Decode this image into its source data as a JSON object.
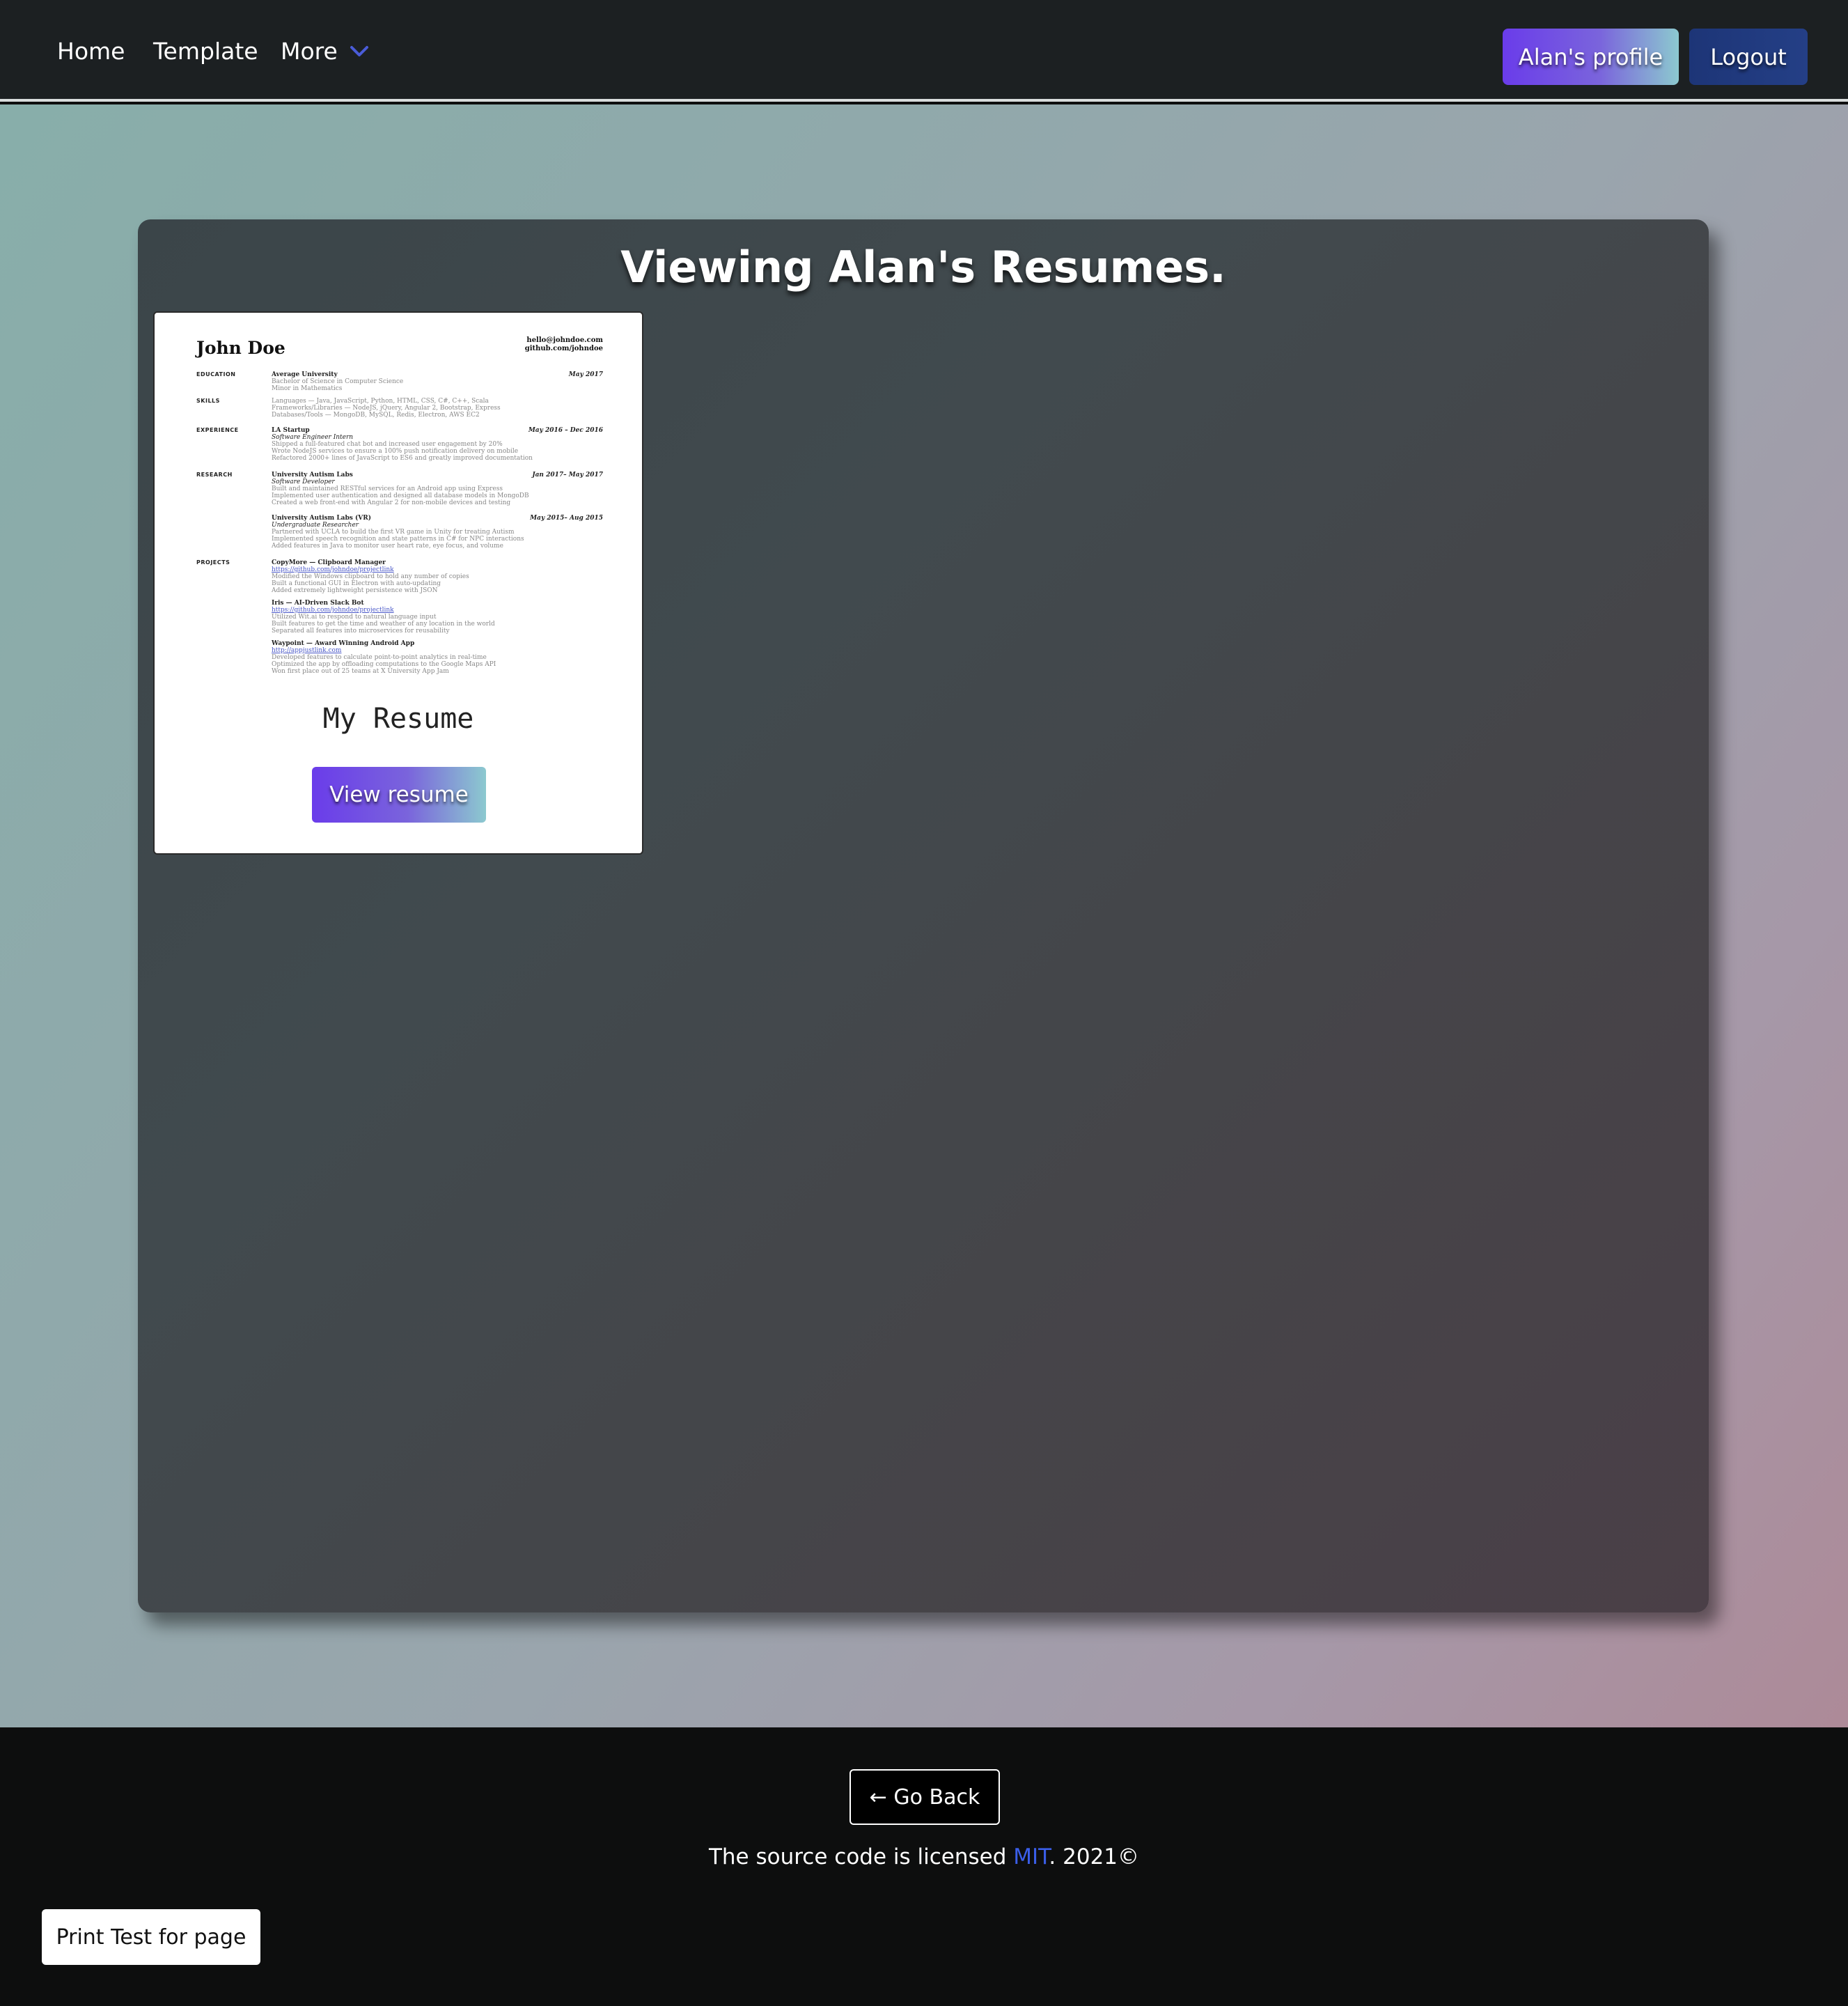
{
  "nav": {
    "home": "Home",
    "template": "Template",
    "more": "More",
    "more_icon": "chevron-down-icon",
    "profile_button": "Alan's profile",
    "logout_button": "Logout"
  },
  "main": {
    "title": "Viewing Alan's Resumes.",
    "cards": [
      {
        "title": "My Resume",
        "view_button": "View resume",
        "preview": {
          "name": "John Doe",
          "contact_email": "hello@johndoe.com",
          "contact_github": "github.com/johndoe",
          "education_label": "EDUCATION",
          "education_school": "Average University",
          "education_date": "May 2017",
          "education_degree": "Bachelor of Science in Computer Science",
          "education_minor": "Minor in Mathematics",
          "skills_label": "SKILLS",
          "skills_languages": "Languages — Java, JavaScript, Python, HTML, CSS, C#, C++, Scala",
          "skills_frameworks": "Frameworks/Libraries — NodeJS, jQuery, Angular 2, Bootstrap, Express",
          "skills_databases": "Databases/Tools — MongoDB, MySQL, Redis, Electron, AWS EC2",
          "experience_label": "EXPERIENCE",
          "exp_company": "LA Startup",
          "exp_date": "May 2016 – Dec 2016",
          "exp_role": "Software Engineer Intern",
          "exp_b1": "Shipped a full-featured chat bot and increased user engagement by 20%",
          "exp_b2": "Wrote NodeJS services to ensure a 100% push notification delivery on mobile",
          "exp_b3": "Refactored 2000+ lines of JavaScript to ES6 and greatly improved documentation",
          "research_label": "RESEARCH",
          "res1_org": "University Autism Labs",
          "res1_date": "Jan 2017– May 2017",
          "res1_role": "Software Developer",
          "res1_b1": "Built and maintained RESTful services for an Android app using Express",
          "res1_b2": "Implemented user authentication and designed all database models in MongoDB",
          "res1_b3": "Created a web front-end with Angular 2 for non-mobile devices and testing",
          "res2_org": "University Autism Labs (VR)",
          "res2_date": "May 2015– Aug 2015",
          "res2_role": "Undergraduate Researcher",
          "res2_b1": "Partnered with UCLA to build the first VR game in Unity for treating Autism",
          "res2_b2": "Implemented speech recognition and state patterns in C# for NPC interactions",
          "res2_b3": "Added features in Java to monitor user heart rate, eye focus, and volume",
          "projects_label": "PROJECTS",
          "p1_name": "CopyMore — Clipboard Manager",
          "p1_link": "https://github.com/johndoe/projectlink",
          "p1_b1": "Modified the Windows clipboard to hold any number of copies",
          "p1_b2": "Built a functional GUI in Electron with auto-updating",
          "p1_b3": "Added extremely lightweight persistence with JSON",
          "p2_name": "Iris — AI-Driven Slack Bot",
          "p2_link": "https://github.com/johndoe/projectlink",
          "p2_b1": "Utilized Wit.ai to respond to natural language input",
          "p2_b2": "Built features to get the time and weather of any location in the world",
          "p2_b3": "Separated all features into microservices for reusability",
          "p3_name": "Waypoint — Award Winning Android App",
          "p3_link": "http://appjustlink.com",
          "p3_b1": "Developed features to calculate point-to-point analytics in real-time",
          "p3_b2": "Optimized the app by offloading computations to the Google Maps API",
          "p3_b3": "Won first place out of 25 teams at X University App Jam"
        }
      }
    ]
  },
  "footer": {
    "back_button": "← Go Back",
    "license_prefix": "The source code is licensed ",
    "license_link": "MIT",
    "license_suffix": ". 2021©",
    "print_button": "Print Test for page"
  },
  "colors": {
    "accent_link": "#3a5ee8",
    "navbar_bg": "#1c2022",
    "logout_bg": "#1d3577"
  }
}
